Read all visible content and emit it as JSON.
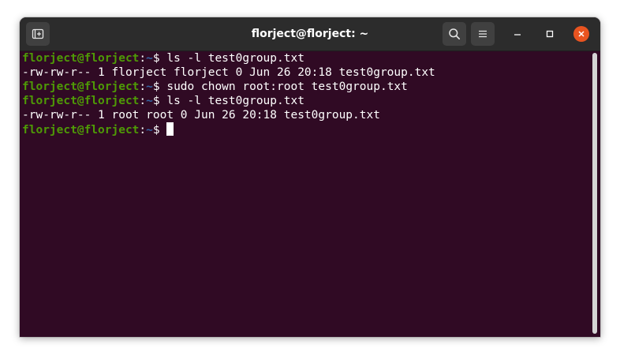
{
  "window": {
    "title": "florject@florject: ~"
  },
  "icons": {
    "new_tab": "new-tab-icon",
    "search": "search-icon",
    "menu": "hamburger-menu-icon",
    "minimize": "minimize-icon",
    "maximize": "maximize-icon",
    "close": "close-icon"
  },
  "colors": {
    "terminal_bg": "#300a24",
    "titlebar_bg": "#2c2c2c",
    "prompt_user": "#4e9a06",
    "prompt_path": "#3465a4",
    "close_button": "#e95420"
  },
  "terminal": {
    "lines": [
      {
        "type": "prompt",
        "user": "florject@florject",
        "sep": ":",
        "path": "~",
        "symbol": "$ ",
        "command": "ls -l test0group.txt"
      },
      {
        "type": "output",
        "text": "-rw-rw-r-- 1 florject florject 0 Jun 26 20:18 test0group.txt"
      },
      {
        "type": "prompt",
        "user": "florject@florject",
        "sep": ":",
        "path": "~",
        "symbol": "$ ",
        "command": "sudo chown root:root test0group.txt"
      },
      {
        "type": "prompt",
        "user": "florject@florject",
        "sep": ":",
        "path": "~",
        "symbol": "$ ",
        "command": "ls -l test0group.txt"
      },
      {
        "type": "output",
        "text": "-rw-rw-r-- 1 root root 0 Jun 26 20:18 test0group.txt"
      },
      {
        "type": "prompt",
        "user": "florject@florject",
        "sep": ":",
        "path": "~",
        "symbol": "$ ",
        "command": ""
      }
    ]
  }
}
